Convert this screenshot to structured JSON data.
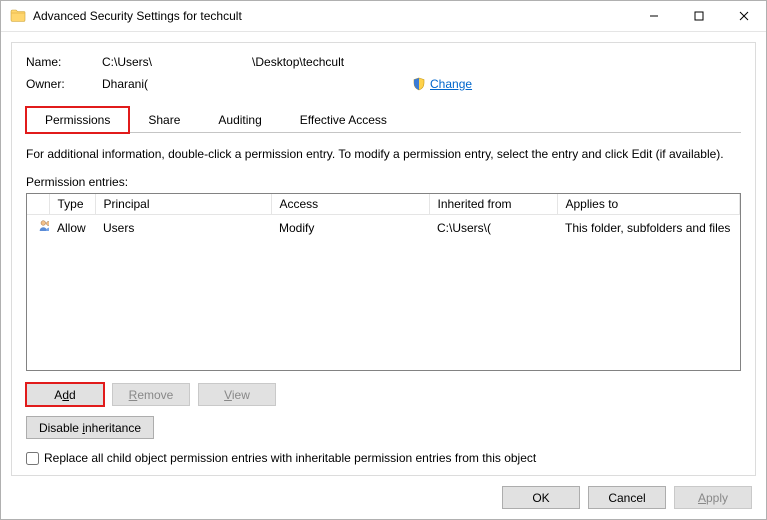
{
  "window": {
    "title": "Advanced Security Settings for techcult"
  },
  "info": {
    "name_label": "Name:",
    "name_value": "C:\\Users\\                              \\Desktop\\techcult",
    "owner_label": "Owner:",
    "owner_value": "Dharani(",
    "change_label": "Change"
  },
  "tabs": {
    "permissions": "Permissions",
    "share": "Share",
    "auditing": "Auditing",
    "effective": "Effective Access"
  },
  "hint": "For additional information, double-click a permission entry. To modify a permission entry, select the entry and click Edit (if available).",
  "section_label": "Permission entries:",
  "columns": {
    "type": "Type",
    "principal": "Principal",
    "access": "Access",
    "inherited": "Inherited from",
    "applies": "Applies to"
  },
  "entries": [
    {
      "type": "Allow",
      "principal": "Users",
      "access": "Modify",
      "inherited": "C:\\Users\\(",
      "applies": "This folder, subfolders and files"
    }
  ],
  "buttons": {
    "add": "Add",
    "remove": "Remove",
    "view": "View",
    "disable_inherit": "Disable inheritance",
    "ok": "OK",
    "cancel": "Cancel",
    "apply": "Apply"
  },
  "checkbox": {
    "label": "Replace all child object permission entries with inheritable permission entries from this object"
  }
}
